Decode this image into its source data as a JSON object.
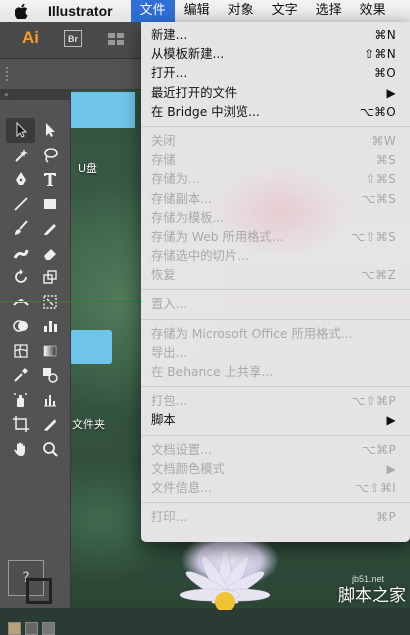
{
  "menubar": {
    "app_name": "Illustrator",
    "menus": [
      "文件",
      "编辑",
      "对象",
      "文字",
      "选择",
      "效果"
    ],
    "active_menu": "文件"
  },
  "app": {
    "ai_logo": "Ai",
    "bridge_logo": "Br"
  },
  "desktop": {
    "label_usb": "U盘",
    "label_folder": "文件夹"
  },
  "tools_panel": {
    "header_glyph": "«"
  },
  "file_menu": {
    "items": [
      {
        "label": "新建...",
        "shortcut": "⌘N",
        "enabled": true
      },
      {
        "label": "从模板新建...",
        "shortcut": "⇧⌘N",
        "enabled": true
      },
      {
        "label": "打开...",
        "shortcut": "⌘O",
        "enabled": true
      },
      {
        "label": "最近打开的文件",
        "shortcut": "▶",
        "enabled": true
      },
      {
        "label": "在 Bridge 中浏览...",
        "shortcut": "⌥⌘O",
        "enabled": true
      },
      {
        "label": "关闭",
        "shortcut": "⌘W",
        "enabled": false
      },
      {
        "label": "存储",
        "shortcut": "⌘S",
        "enabled": false
      },
      {
        "label": "存储为...",
        "shortcut": "⇧⌘S",
        "enabled": false
      },
      {
        "label": "存储副本...",
        "shortcut": "⌥⌘S",
        "enabled": false
      },
      {
        "label": "存储为模板...",
        "shortcut": "",
        "enabled": false
      },
      {
        "label": "存储为 Web 所用格式...",
        "shortcut": "⌥⇧⌘S",
        "enabled": false
      },
      {
        "label": "存储选中的切片...",
        "shortcut": "",
        "enabled": false
      },
      {
        "label": "恢复",
        "shortcut": "⌥⌘Z",
        "enabled": false
      },
      {
        "label": "置入...",
        "shortcut": "",
        "enabled": false
      },
      {
        "label": "存储为 Microsoft Office 所用格式...",
        "shortcut": "",
        "enabled": false
      },
      {
        "label": "导出...",
        "shortcut": "",
        "enabled": false
      },
      {
        "label": "在 Behance 上共享...",
        "shortcut": "",
        "enabled": false
      },
      {
        "label": "打包...",
        "shortcut": "⌥⇧⌘P",
        "enabled": false
      },
      {
        "label": "脚本",
        "shortcut": "▶",
        "enabled": true
      },
      {
        "label": "文档设置...",
        "shortcut": "⌥⌘P",
        "enabled": false
      },
      {
        "label": "文档颜色模式",
        "shortcut": "▶",
        "enabled": false
      },
      {
        "label": "文件信息...",
        "shortcut": "⌥⇧⌘I",
        "enabled": false
      },
      {
        "label": "打印...",
        "shortcut": "⌘P",
        "enabled": false
      }
    ]
  },
  "watermark": {
    "site": "jb51.net",
    "text": "脚本之家"
  },
  "colors": {
    "menu_highlight": "#2f6fd6",
    "panel_bg": "#535353",
    "guide_red": "#c6343a",
    "ai_orange": "#f79a26",
    "desktop_blue": "#6fc4ea"
  }
}
